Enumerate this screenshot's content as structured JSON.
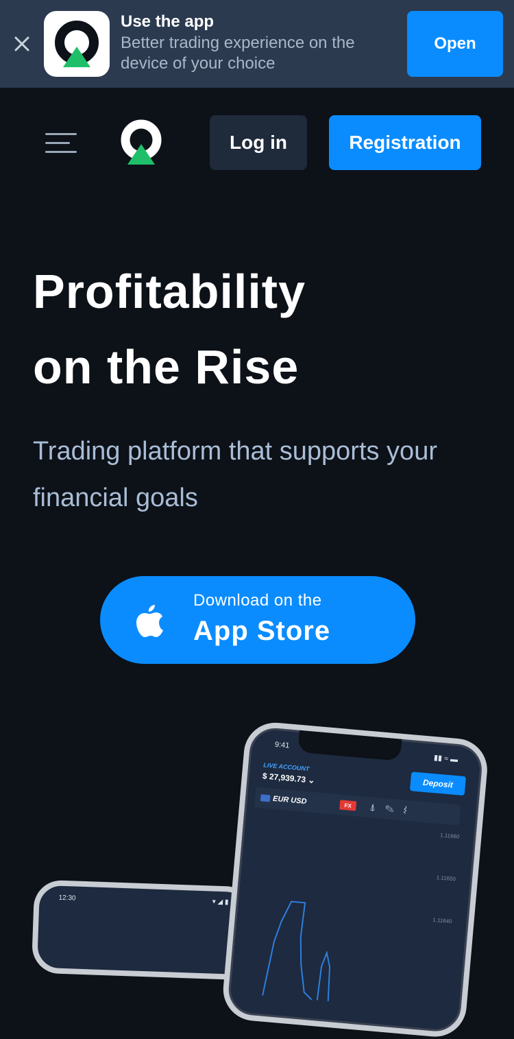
{
  "banner": {
    "title": "Use the app",
    "subtitle": "Better trading experience on the device of your choice",
    "open_label": "Open"
  },
  "header": {
    "login_label": "Log in",
    "registration_label": "Registration"
  },
  "hero": {
    "title_line1": "Profitability",
    "title_line2": "on the Rise",
    "subtitle": "Trading platform that supports your financial goals"
  },
  "store_button": {
    "small_text": "Download on the",
    "big_text": "App Store"
  },
  "phone_main": {
    "time": "9:41",
    "account_label": "LIVE ACCOUNT",
    "account_value": "$ 27,939.73",
    "deposit_label": "Deposit",
    "pair": "EUR USD",
    "badge": "FX",
    "prices": [
      "1.11660",
      "1.11650",
      "1.11640"
    ]
  },
  "phone_left": {
    "time": "12:30"
  },
  "colors": {
    "background": "#0d1118",
    "accent": "#0a8cff",
    "banner": "#2b3a4f",
    "logo_green": "#1fbf6a"
  }
}
